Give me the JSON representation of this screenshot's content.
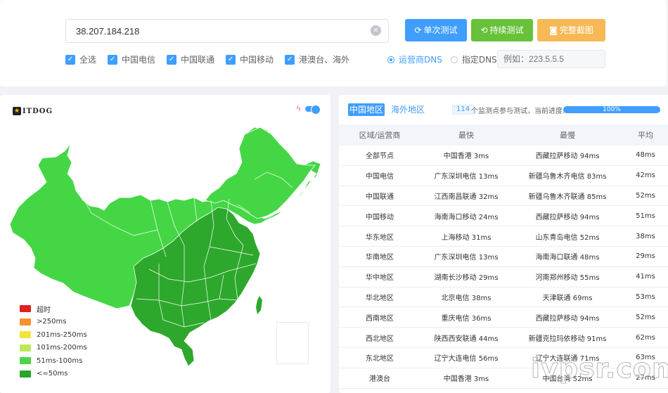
{
  "input": {
    "ip_value": "38.207.184.218"
  },
  "buttons": {
    "single": "单次测试",
    "continuous": "持续测试",
    "screenshot": "完整截图"
  },
  "filters": [
    "全选",
    "中国电信",
    "中国联通",
    "中国移动",
    "港澳台、海外"
  ],
  "dns": {
    "isp_label": "运营商DNS",
    "custom_label": "指定DNS:",
    "placeholder": "例如：223.5.5.5"
  },
  "map": {
    "logo_text": "ITDOG",
    "legend": [
      {
        "label": "超时",
        "color": "#e02020"
      },
      {
        "label": ">250ms",
        "color": "#f7922d"
      },
      {
        "label": "201ms-250ms",
        "color": "#f5e33d"
      },
      {
        "label": "101ms-200ms",
        "color": "#bde85a"
      },
      {
        "label": "51ms-100ms",
        "color": "#4cd44a"
      },
      {
        "label": "<=50ms",
        "color": "#29a529"
      }
    ],
    "colors": {
      "fast": "#2da82c",
      "medium": "#45d646"
    }
  },
  "results": {
    "tabs": {
      "china": "中国地区",
      "overseas": "海外地区"
    },
    "node_count": "114",
    "node_text": "个监测点参与测试，当前进度:",
    "progress": 100,
    "progress_label": "100%",
    "columns": [
      "区域/运营商",
      "最快",
      "最慢",
      "平均"
    ],
    "rows": [
      [
        "全部节点",
        "中国香港 3ms",
        "西藏拉萨移动 94ms",
        "48ms"
      ],
      [
        "中国电信",
        "广东深圳电信 13ms",
        "新疆乌鲁木齐电信 83ms",
        "42ms"
      ],
      [
        "中国联通",
        "江西南昌联通 32ms",
        "新疆乌鲁木齐联通 85ms",
        "52ms"
      ],
      [
        "中国移动",
        "海南海口移动 24ms",
        "西藏拉萨移动 94ms",
        "51ms"
      ],
      [
        "华东地区",
        "上海移动 31ms",
        "山东青岛电信 52ms",
        "38ms"
      ],
      [
        "华南地区",
        "广东深圳电信 13ms",
        "海南海口联通 48ms",
        "29ms"
      ],
      [
        "华中地区",
        "湖南长沙移动 29ms",
        "河南郑州移动 55ms",
        "41ms"
      ],
      [
        "华北地区",
        "北京电信 38ms",
        "天津联通 69ms",
        "53ms"
      ],
      [
        "西南地区",
        "重庆电信 36ms",
        "西藏拉萨移动 94ms",
        "52ms"
      ],
      [
        "西北地区",
        "陕西西安联通 44ms",
        "新疆克拉玛依移动 91ms",
        "62ms"
      ],
      [
        "东北地区",
        "辽宁大连电信 56ms",
        "辽宁大连联通 71ms",
        "63ms"
      ],
      [
        "港澳台",
        "中国香港 3ms",
        "中国台湾 52ms",
        "27ms"
      ]
    ]
  },
  "watermark": "ivpsr.com"
}
